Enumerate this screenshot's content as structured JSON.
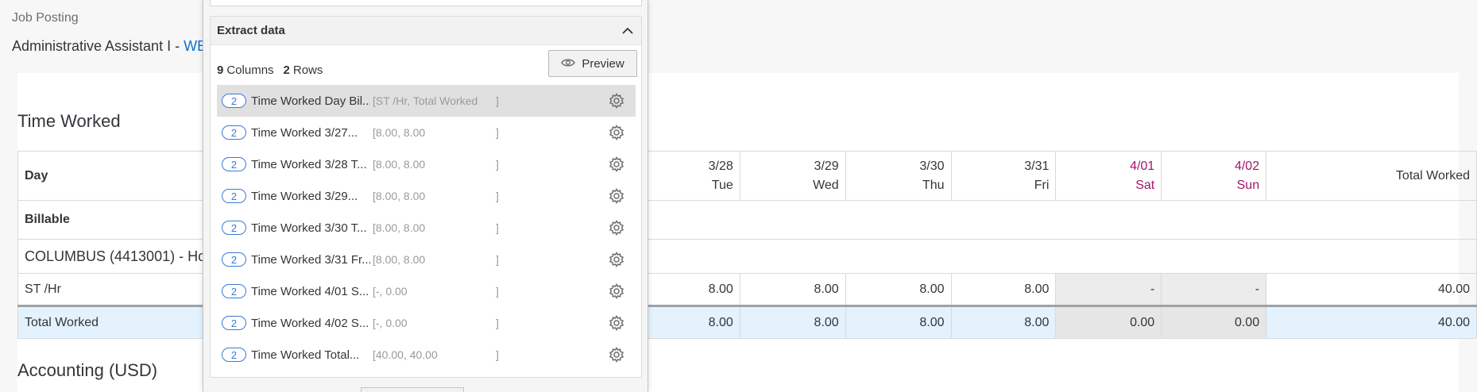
{
  "header": {
    "breadcrumb": "Job Posting",
    "title_prefix": "Administrative Assistant I - ",
    "title_link": "WEF"
  },
  "section": {
    "time_worked": "Time Worked",
    "accounting": "Accounting (USD)"
  },
  "table": {
    "row_day": "Day",
    "row_billable": "Billable",
    "row_location": "COLUMBUS (4413001) - Ho",
    "row_st": "ST /Hr",
    "row_total": "Total Worked",
    "columns": [
      {
        "date": "3/28",
        "day": "Tue"
      },
      {
        "date": "3/29",
        "day": "Wed"
      },
      {
        "date": "3/30",
        "day": "Thu"
      },
      {
        "date": "3/31",
        "day": "Fri"
      },
      {
        "date": "4/01",
        "day": "Sat"
      },
      {
        "date": "4/02",
        "day": "Sun"
      }
    ],
    "total_header": "Total Worked",
    "st_values": [
      "8.00",
      "8.00",
      "8.00",
      "8.00",
      "-",
      "-",
      "40.00"
    ],
    "total_values": [
      "8.00",
      "8.00",
      "8.00",
      "8.00",
      "0.00",
      "0.00",
      "40.00"
    ],
    "colors": {
      "weekend": "#a0176b",
      "total_row": "#e3f2fc"
    }
  },
  "panel": {
    "section_title": "Extract data",
    "columns_count": "9",
    "columns_label": "Columns",
    "rows_count": "2",
    "rows_label": "Rows",
    "preview_label": "Preview",
    "items": [
      {
        "count": "2",
        "name": "Time Worked Day Bil...",
        "values": "[ST /Hr, Total Worked",
        "close": "]"
      },
      {
        "count": "2",
        "name": "Time Worked 3/27...",
        "values": "[8.00, 8.00",
        "close": "]"
      },
      {
        "count": "2",
        "name": "Time Worked 3/28 T...",
        "values": "[8.00, 8.00",
        "close": "]"
      },
      {
        "count": "2",
        "name": "Time Worked 3/29...",
        "values": "[8.00, 8.00",
        "close": "]"
      },
      {
        "count": "2",
        "name": "Time Worked 3/30 T...",
        "values": "[8.00, 8.00",
        "close": "]"
      },
      {
        "count": "2",
        "name": "Time Worked 3/31 Fr...",
        "values": "[8.00, 8.00",
        "close": "]"
      },
      {
        "count": "2",
        "name": "Time Worked 4/01 S...",
        "values": "[-, 0.00",
        "close": "]"
      },
      {
        "count": "2",
        "name": "Time Worked 4/02 S...",
        "values": "[-, 0.00",
        "close": "]"
      },
      {
        "count": "2",
        "name": "Time Worked Total...",
        "values": "[40.00, 40.00",
        "close": "]"
      }
    ],
    "accent_color": "#3a7bd5"
  }
}
